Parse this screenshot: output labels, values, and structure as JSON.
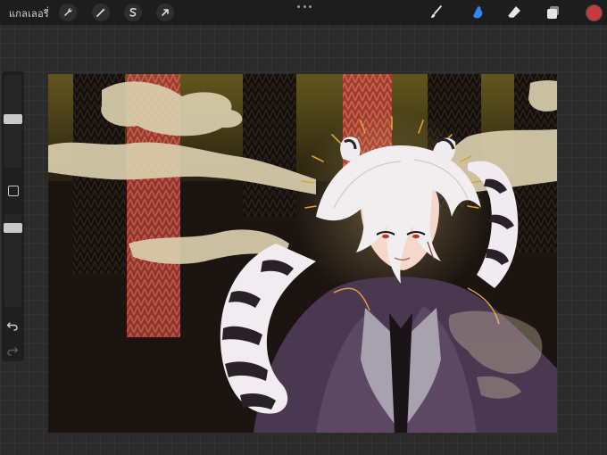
{
  "topbar": {
    "gallery_label": "แกลเลอรี่",
    "left_tools": [
      {
        "name": "actions",
        "icon": "wrench-icon"
      },
      {
        "name": "adjustments",
        "icon": "magic-wand-icon"
      },
      {
        "name": "selection",
        "icon": "selection-s-icon"
      },
      {
        "name": "transform",
        "icon": "arrow-cursor-icon"
      }
    ],
    "more_icon": "ellipsis-icon",
    "right_tools": [
      {
        "name": "brush",
        "icon": "brush-icon",
        "active": false
      },
      {
        "name": "smudge",
        "icon": "smudge-finger-icon",
        "active": true
      },
      {
        "name": "eraser",
        "icon": "eraser-icon",
        "active": false
      },
      {
        "name": "layers",
        "icon": "layers-icon",
        "active": false
      }
    ],
    "current_color": "#c8393b",
    "active_tool_color": "#2f86f5"
  },
  "sidebar": {
    "brush_size_level": 0.55,
    "opacity_level": 0.15,
    "modify_icon": "square-outline-icon",
    "undo_icon": "undo-arrow-icon",
    "redo_icon": "redo-arrow-icon"
  },
  "canvas": {
    "content": "digital-painting",
    "palette": {
      "background": "#1b1410",
      "stripe_gold": "#6b5c1c",
      "stripe_red": "#b6463b",
      "cloud": "#d9cfae",
      "hair": "#f1eef0",
      "suit": "#55405a",
      "accent_gold": "#d9a33a"
    }
  }
}
